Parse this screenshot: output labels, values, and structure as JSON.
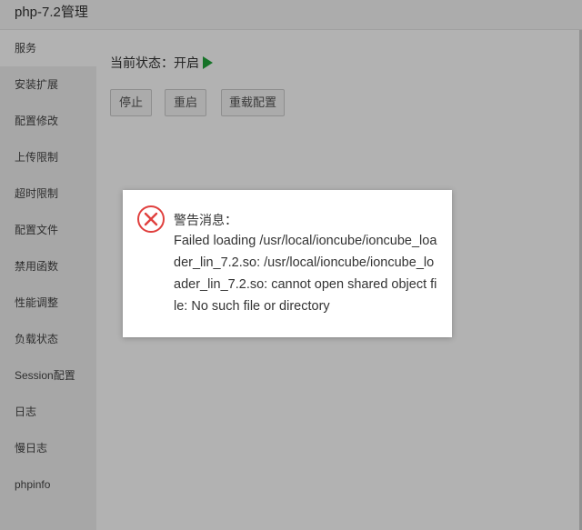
{
  "window": {
    "title": "php-7.2管理"
  },
  "sidebar": {
    "items": [
      {
        "label": "服务"
      },
      {
        "label": "安装扩展"
      },
      {
        "label": "配置修改"
      },
      {
        "label": "上传限制"
      },
      {
        "label": "超时限制"
      },
      {
        "label": "配置文件"
      },
      {
        "label": "禁用函数"
      },
      {
        "label": "性能调整"
      },
      {
        "label": "负载状态"
      },
      {
        "label": "Session配置"
      },
      {
        "label": "日志"
      },
      {
        "label": "慢日志"
      },
      {
        "label": "phpinfo"
      }
    ]
  },
  "main": {
    "status_text": "当前状态：开启",
    "status_icon": "play-icon",
    "status_color": "#20a53a",
    "buttons": {
      "stop": "停止",
      "restart": "重启",
      "reload": "重载配置"
    }
  },
  "dialog": {
    "icon": "error-circle-x-icon",
    "icon_color": "#e0403e",
    "title": "警告消息：",
    "message": "Failed loading /usr/local/ioncube/ioncube_loader_lin_7.2.so: /usr/local/ioncube/ioncube_loader_lin_7.2.so: cannot open shared object file: No such file or directory"
  }
}
